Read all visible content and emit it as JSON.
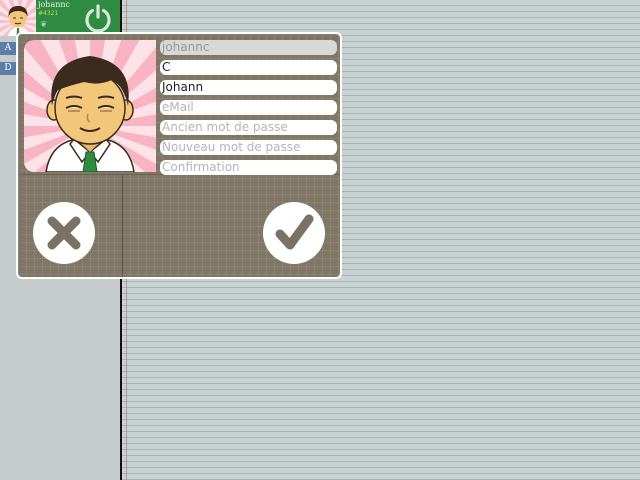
{
  "user": {
    "name": "johannc",
    "score": "#4321"
  },
  "side_tabs": [
    "A",
    "D"
  ],
  "profile_form": {
    "username_value": "johannc",
    "lastname_value": "C",
    "firstname_value": "Johann",
    "email_placeholder": "eMail",
    "old_password_placeholder": "Ancien mot de passe",
    "new_password_placeholder": "Nouveau mot de passe",
    "confirm_placeholder": "Confirmation"
  },
  "icons": {
    "power": "power-icon",
    "leaf": "leaf-icon",
    "cancel": "close-icon",
    "confirm": "check-icon"
  },
  "colors": {
    "user_card": "#2f8b42",
    "dialog_bg": "#7f7665",
    "side_tab": "#5a7ea8",
    "button_icon": "#7a7264"
  }
}
